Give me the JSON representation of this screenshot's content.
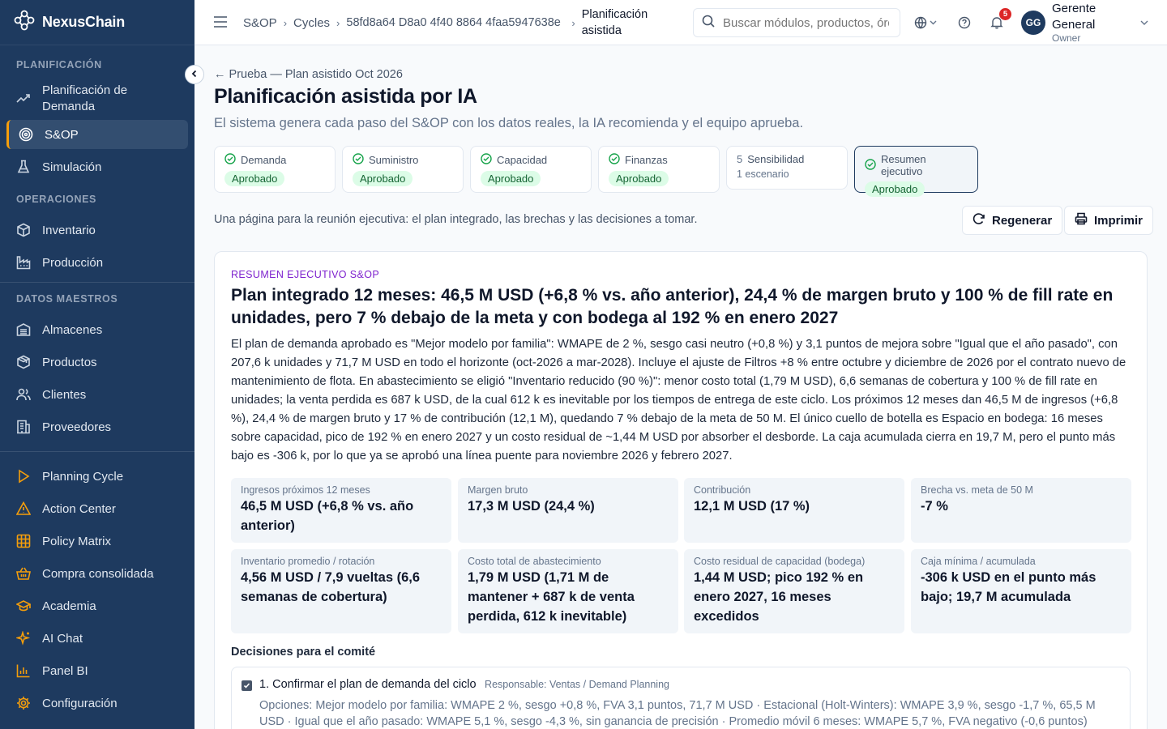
{
  "app": {
    "name": "NexusChain"
  },
  "sidebar": {
    "sections": [
      {
        "title": "PLANIFICACIÓN",
        "items": [
          {
            "label": "Planificación de Demanda",
            "icon": "trend-icon"
          },
          {
            "label": "S&OP",
            "icon": "target-icon",
            "active": true
          },
          {
            "label": "Simulación",
            "icon": "flask-icon"
          }
        ]
      },
      {
        "title": "OPERACIONES",
        "items": [
          {
            "label": "Inventario",
            "icon": "box-icon"
          },
          {
            "label": "Producción",
            "icon": "factory-icon"
          }
        ]
      },
      {
        "title": "DATOS MAESTROS",
        "items": [
          {
            "label": "Almacenes",
            "icon": "warehouse-icon"
          },
          {
            "label": "Productos",
            "icon": "package-icon"
          },
          {
            "label": "Clientes",
            "icon": "users-icon"
          },
          {
            "label": "Proveedores",
            "icon": "building-icon"
          }
        ]
      }
    ],
    "tools": [
      {
        "label": "Planning Cycle",
        "icon": "play-icon"
      },
      {
        "label": "Action Center",
        "icon": "alert-icon"
      },
      {
        "label": "Policy Matrix",
        "icon": "grid-icon"
      },
      {
        "label": "Compra consolidada",
        "icon": "basket-icon"
      },
      {
        "label": "Academia",
        "icon": "graduation-icon"
      },
      {
        "label": "AI Chat",
        "icon": "sparkle-icon"
      },
      {
        "label": "Panel BI",
        "icon": "bar-chart-icon"
      },
      {
        "label": "Configuración",
        "icon": "gear-icon"
      }
    ],
    "accent": "#f59e0b"
  },
  "header": {
    "breadcrumb": [
      "S&OP",
      "Cycles",
      "58fd8a64 D8a0 4f40 8864 4faa5947638e",
      "Planificación asistida"
    ],
    "search_placeholder": "Buscar módulos, productos, órdenes...",
    "notifications": "5",
    "user": {
      "initials": "GG",
      "name": "Gerente General",
      "role": "Owner"
    }
  },
  "page": {
    "back": "Prueba — Plan asistido Oct 2026",
    "title": "Planificación asistida por IA",
    "subtitle": "El sistema genera cada paso del S&OP con los datos reales, la IA recomienda y el equipo aprueba.",
    "steps": [
      {
        "label": "Demanda",
        "status": "Aprobado"
      },
      {
        "label": "Suministro",
        "status": "Aprobado"
      },
      {
        "label": "Capacidad",
        "status": "Aprobado"
      },
      {
        "label": "Finanzas",
        "status": "Aprobado"
      },
      {
        "num": "5",
        "label": "Sensibilidad",
        "sub": "1 escenario"
      },
      {
        "label": "Resumen ejecutivo",
        "status": "Aprobado"
      }
    ],
    "description": "Una página para la reunión ejecutiva: el plan integrado, las brechas y las decisiones a tomar.",
    "regenerate": "Regenerar",
    "print": "Imprimir"
  },
  "summary": {
    "eyebrow": "RESUMEN EJECUTIVO S&OP",
    "title": "Plan integrado 12 meses: 46,5 M USD (+6,8 % vs. año anterior), 24,4 % de margen bruto y 100 % de fill rate en unidades, pero 7 % debajo de la meta y con bodega al 192 % en enero 2027",
    "body": "El plan de demanda aprobado es \"Mejor modelo por familia\": WMAPE de 2 %, sesgo casi neutro (+0,8 %) y 3,1 puntos de mejora sobre \"Igual que el año pasado\", con 207,6 k unidades y 71,7 M USD en todo el horizonte (oct-2026 a mar-2028). Incluye el ajuste de Filtros +8 % entre octubre y diciembre de 2026 por el contrato nuevo de mantenimiento de flota. En abastecimiento se eligió \"Inventario reducido (90 %)\": menor costo total (1,79 M USD), 6,6 semanas de cobertura y 100 % de fill rate en unidades; la venta perdida es 687 k USD, de la cual 612 k es inevitable por los tiempos de entrega de este ciclo. Los próximos 12 meses dan 46,5 M de ingresos (+6,8 %), 24,4 % de margen bruto y 17 % de contribución (12,1 M), quedando 7 % debajo de la meta de 50 M. El único cuello de botella es Espacio en bodega: 16 meses sobre capacidad, pico de 192 % en enero 2027 y un costo residual de ~1,44 M USD por absorber el desborde. La caja acumulada cierra en 19,7 M, pero el punto más bajo es -306 k, por lo que ya se aprobó una línea puente para noviembre 2026 y febrero 2027.",
    "kpis": [
      {
        "label": "Ingresos próximos 12 meses",
        "value": "46,5 M USD (+6,8 % vs. año anterior)"
      },
      {
        "label": "Margen bruto",
        "value": "17,3 M USD (24,4 %)"
      },
      {
        "label": "Contribución",
        "value": "12,1 M USD (17 %)"
      },
      {
        "label": "Brecha vs. meta de 50 M",
        "value": "-7 %"
      },
      {
        "label": "Inventario promedio / rotación",
        "value": "4,56 M USD / 7,9 vueltas (6,6 semanas de cobertura)"
      },
      {
        "label": "Costo total de abastecimiento",
        "value": "1,79 M USD (1,71 M de mantener + 687 k de venta perdida, 612 k inevitable)"
      },
      {
        "label": "Costo residual de capacidad (bodega)",
        "value": "1,44 M USD; pico 192 % en enero 2027, 16 meses excedidos"
      },
      {
        "label": "Caja mínima / acumulada",
        "value": "-306 k USD en el punto más bajo; 19,7 M acumulada"
      }
    ],
    "decisions_title": "Decisiones para el comité",
    "decisions": [
      {
        "title": "1. Confirmar el plan de demanda del ciclo",
        "owner": "Responsable: Ventas / Demand Planning",
        "checked": true,
        "options": "Opciones: Mejor modelo por familia: WMAPE 2 %, sesgo +0,8 %, FVA 3,1 puntos, 71,7 M USD · Estacional (Holt-Winters): WMAPE 3,9 %, sesgo -1,7 %, 65,5 M USD · Igual que el año pasado: WMAPE 5,1 %, sesgo -4,3 %, sin ganancia de precisión · Promedio móvil 6 meses: WMAPE 5,7 %, FVA negativo (-0,6 puntos)"
      }
    ]
  }
}
